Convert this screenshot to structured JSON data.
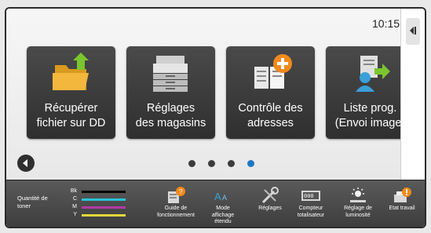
{
  "status": {
    "time": "10:15"
  },
  "tiles": [
    {
      "label": "Récupérer\nfichier sur DD",
      "icon": "folder-arrow-icon"
    },
    {
      "label": "Réglages\ndes magasins",
      "icon": "printer-trays-icon"
    },
    {
      "label": "Contrôle des\nadresses",
      "icon": "address-book-add-icon"
    },
    {
      "label": "Liste prog.\n(Envoi image)",
      "icon": "program-list-send-icon"
    }
  ],
  "pager": {
    "count": 4,
    "active": 3
  },
  "toner": {
    "label": "Quantité de\ntoner",
    "levels": [
      {
        "name": "Bk",
        "color": "#000000"
      },
      {
        "name": "C",
        "color": "#27c3d8"
      },
      {
        "name": "M",
        "color": "#b03aa8"
      },
      {
        "name": "Y",
        "color": "#e2d83a"
      }
    ]
  },
  "tools": [
    {
      "label": "Guide de\nfonctionnement",
      "icon": "guide-book-icon"
    },
    {
      "label": "Mode\naffichage\nétendu",
      "icon": "text-size-icon"
    },
    {
      "label": "Réglages",
      "icon": "wrench-screwdriver-icon"
    },
    {
      "label": "Compteur\ntotalisateur",
      "icon": "counter-icon"
    },
    {
      "label": "Réglage de\nluminosité",
      "icon": "brightness-icon"
    },
    {
      "label": "Etat travail",
      "icon": "job-status-icon"
    }
  ]
}
